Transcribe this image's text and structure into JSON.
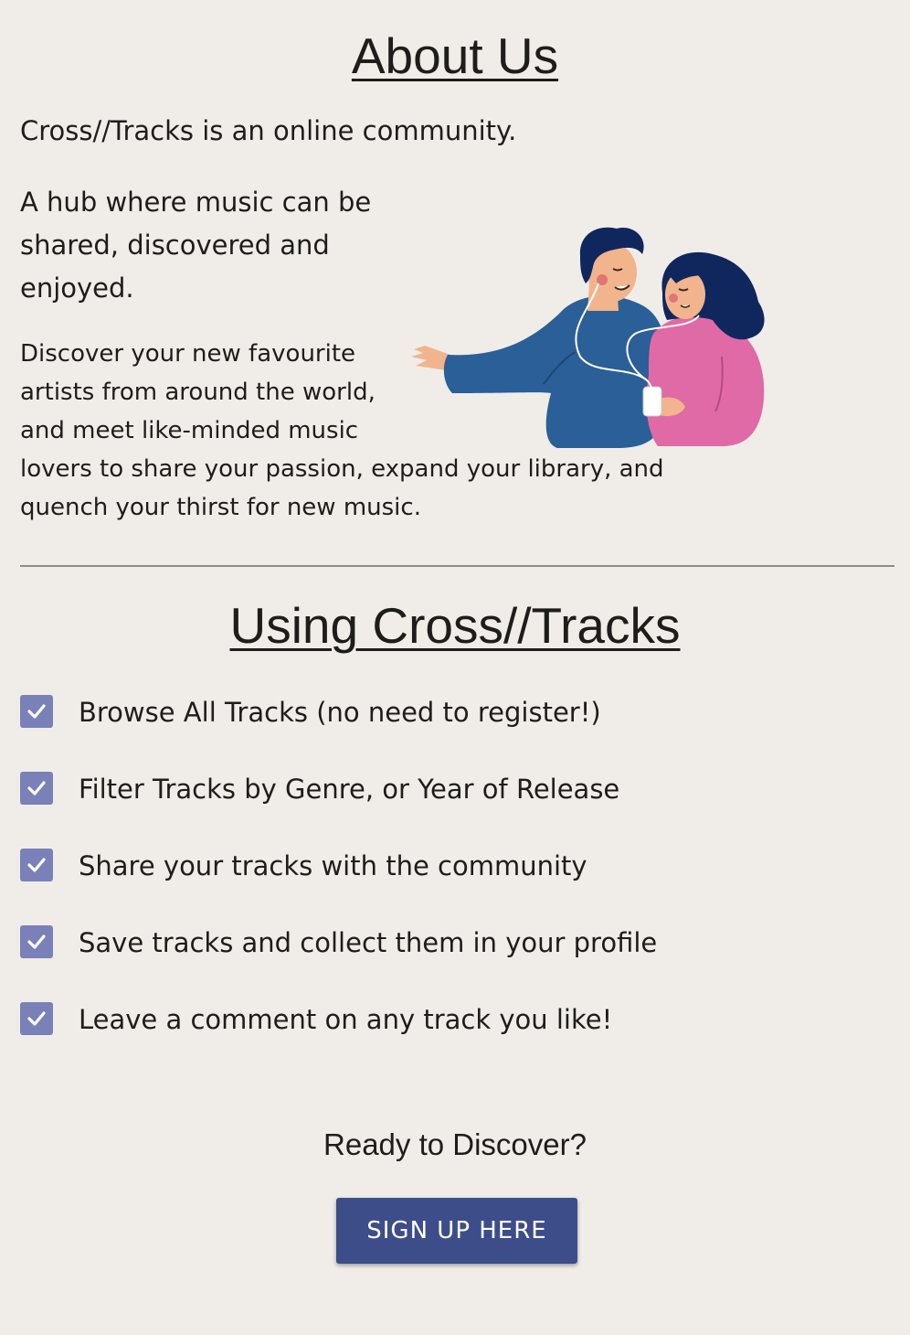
{
  "about": {
    "title": "About Us",
    "intro": "Cross//Tracks is an online community.",
    "hub": "A hub where music can be shared, discovered and enjoyed.",
    "discover": "Discover your new favourite artists from around the world, and meet like-minded music lovers to share your passion, expand your library, and quench your thirst for new music."
  },
  "using": {
    "title": "Using Cross//Tracks",
    "features": [
      {
        "label": "Browse All Tracks (no need to register!)",
        "checked": true
      },
      {
        "label": "Filter Tracks by Genre, or Year of Release",
        "checked": true
      },
      {
        "label": "Share your tracks with the community",
        "checked": true
      },
      {
        "label": "Save tracks and collect them in your profile",
        "checked": true
      },
      {
        "label": "Leave a comment on any track you like!",
        "checked": true
      }
    ]
  },
  "cta": {
    "heading": "Ready to Discover?",
    "button_label": "SIGN UP HERE"
  },
  "colors": {
    "background": "#f0ede8",
    "checkbox": "#7a80b8",
    "button": "#3c4d8a",
    "man_sweater": "#2b5f97",
    "woman_sweater": "#e06aa5",
    "hair": "#10275e"
  }
}
